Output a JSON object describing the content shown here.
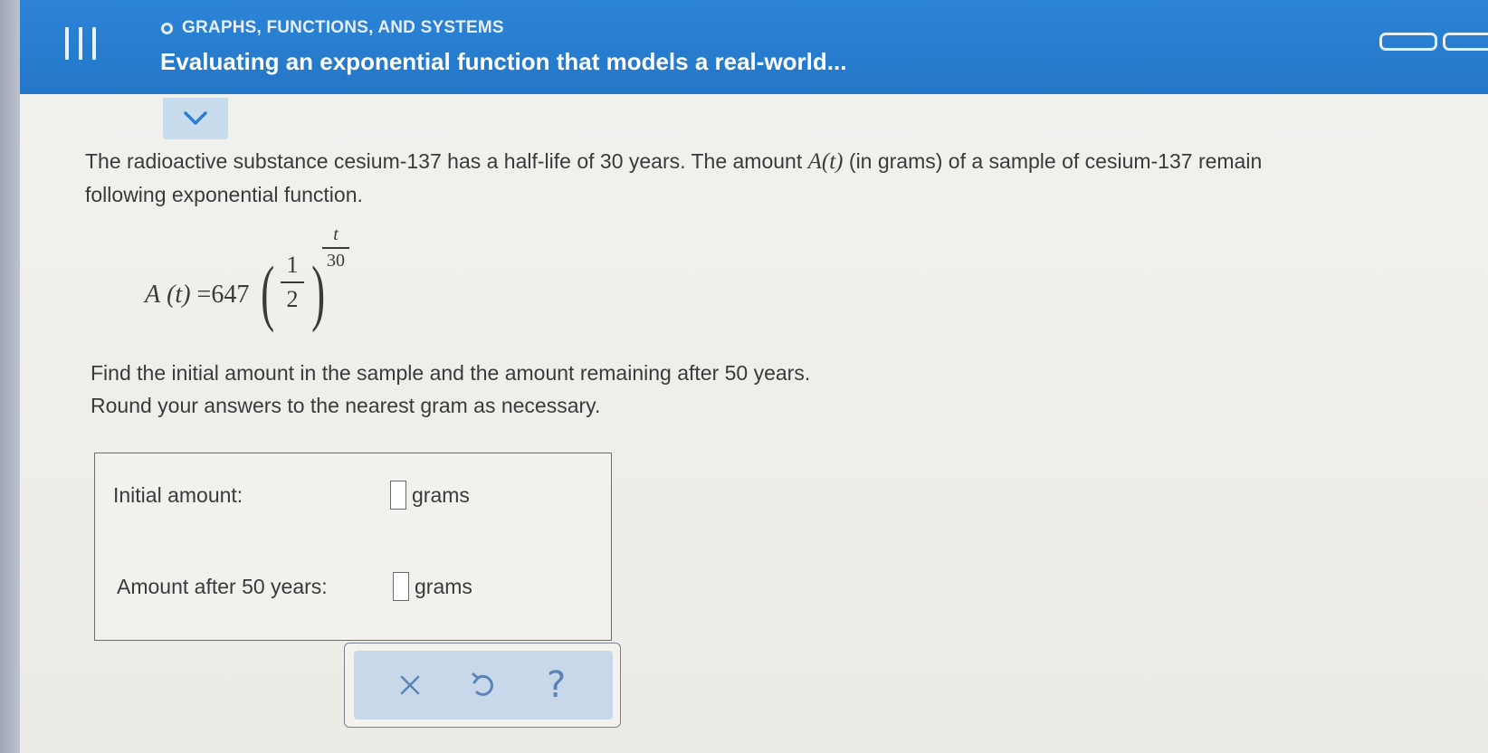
{
  "header": {
    "category": "GRAPHS, FUNCTIONS, AND SYSTEMS",
    "title": "Evaluating an exponential function that models a real-world..."
  },
  "problem": {
    "line1_part1": "The radioactive substance cesium-137 has a half-life of 30 years. The amount ",
    "line1_func": "A",
    "line1_arg": "(t)",
    "line1_part2": " (in grams) of a sample of cesium-137 remain",
    "line2": "following exponential function."
  },
  "equation": {
    "lhs_func": "A",
    "lhs_arg": "(t)",
    "equals": "=",
    "coefficient": "647",
    "base_numerator": "1",
    "base_denominator": "2",
    "exp_numerator": "t",
    "exp_denominator": "30"
  },
  "instructions": {
    "line1": "Find the initial amount in the sample and the amount remaining after 50 years.",
    "line2": "Round your answers to the nearest gram as necessary."
  },
  "answers": {
    "initial_label": "Initial amount:",
    "initial_value": "",
    "initial_unit": "grams",
    "after_label": "Amount after 50 years:",
    "after_value": "",
    "after_unit": "grams"
  },
  "actions": {
    "clear_icon": "x-icon",
    "undo_icon": "undo-icon",
    "help_label": "?"
  },
  "colors": {
    "header_blue": "#2a7fd2",
    "action_panel": "#c8d7ea",
    "icon_blue": "#5a84b8",
    "text": "#3a3a3a"
  }
}
